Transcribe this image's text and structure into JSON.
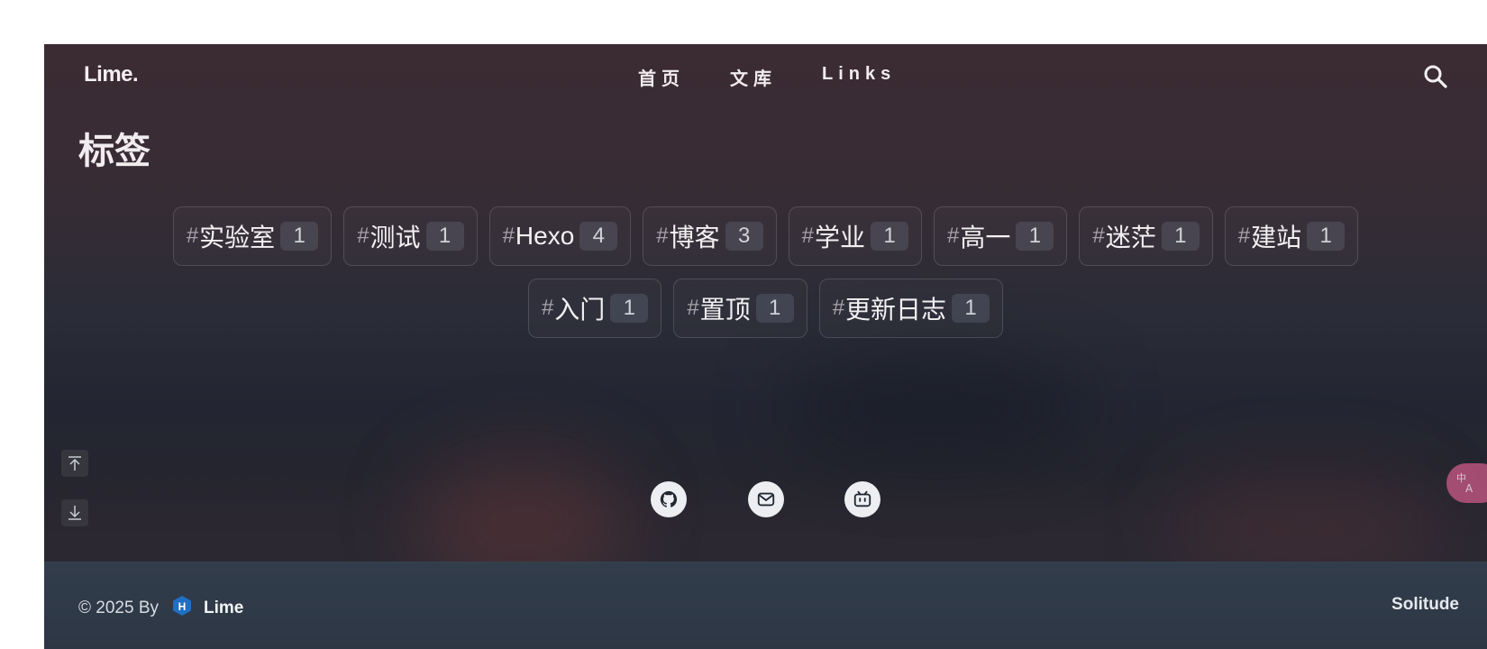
{
  "nav": {
    "logo": "Lime.",
    "items": [
      {
        "label": "首页"
      },
      {
        "label": "文库"
      },
      {
        "label": "Links"
      }
    ],
    "search_icon": "search-icon"
  },
  "page": {
    "title": "标签"
  },
  "tags": {
    "hash": "#",
    "rows": [
      [
        {
          "name": "实验室",
          "count": "1"
        },
        {
          "name": "测试",
          "count": "1"
        },
        {
          "name": "Hexo",
          "count": "4"
        },
        {
          "name": "博客",
          "count": "3"
        },
        {
          "name": "学业",
          "count": "1"
        },
        {
          "name": "高一",
          "count": "1"
        },
        {
          "name": "迷茫",
          "count": "1"
        },
        {
          "name": "建站",
          "count": "1"
        }
      ],
      [
        {
          "name": "入门",
          "count": "1"
        },
        {
          "name": "置顶",
          "count": "1"
        },
        {
          "name": "更新日志",
          "count": "1"
        }
      ]
    ]
  },
  "side_tools": [
    "arrow-up-to-top-icon",
    "arrow-down-to-bottom-icon"
  ],
  "translate": {
    "icon": "translate-icon",
    "color": "#b8547d"
  },
  "social": [
    "github-icon",
    "mail-icon",
    "bilibili-icon"
  ],
  "footer": {
    "copyright": "© 2025 By",
    "author": "Lime",
    "hexo_badge": "H",
    "theme": "Solitude"
  },
  "colors": {
    "bg_top": "#3b2b33",
    "bg_mid": "#232632",
    "footer_bg": "#323d4c",
    "hexo_blue": "#1f6fc4"
  }
}
